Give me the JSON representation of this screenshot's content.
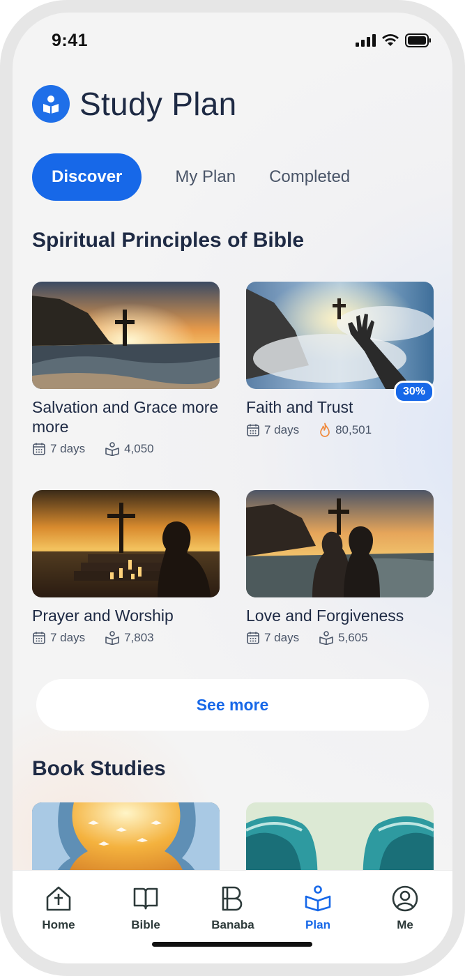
{
  "status": {
    "time": "9:41"
  },
  "header": {
    "title": "Study Plan"
  },
  "tabs": [
    {
      "label": "Discover",
      "active": true
    },
    {
      "label": "My Plan",
      "active": false
    },
    {
      "label": "Completed",
      "active": false
    }
  ],
  "sections": {
    "spiritual": {
      "title": "Spiritual Principles of Bible"
    },
    "book": {
      "title": "Book Studies"
    }
  },
  "plans": [
    {
      "title": "Salvation and Grace more more",
      "days": "7 days",
      "count": "4,050",
      "count_icon": "reader-icon"
    },
    {
      "title": "Faith and Trust",
      "days": "7 days",
      "count": "80,501",
      "count_icon": "flame-icon",
      "progress_label": "30%",
      "progress": 0.3
    },
    {
      "title": "Prayer and Worship",
      "days": "7 days",
      "count": "7,803",
      "count_icon": "reader-icon"
    },
    {
      "title": "Love and Forgiveness",
      "days": "7 days",
      "count": "5,605",
      "count_icon": "reader-icon"
    }
  ],
  "see_more_label": "See more",
  "nav": [
    {
      "label": "Home",
      "icon": "home-cross-icon"
    },
    {
      "label": "Bible",
      "icon": "book-icon"
    },
    {
      "label": "Banaba",
      "icon": "banaba-logo-icon"
    },
    {
      "label": "Plan",
      "icon": "plan-icon",
      "active": true
    },
    {
      "label": "Me",
      "icon": "user-icon"
    }
  ],
  "colors": {
    "accent": "#1768e8",
    "title": "#1e2a44",
    "flame": "#f08a3c"
  }
}
